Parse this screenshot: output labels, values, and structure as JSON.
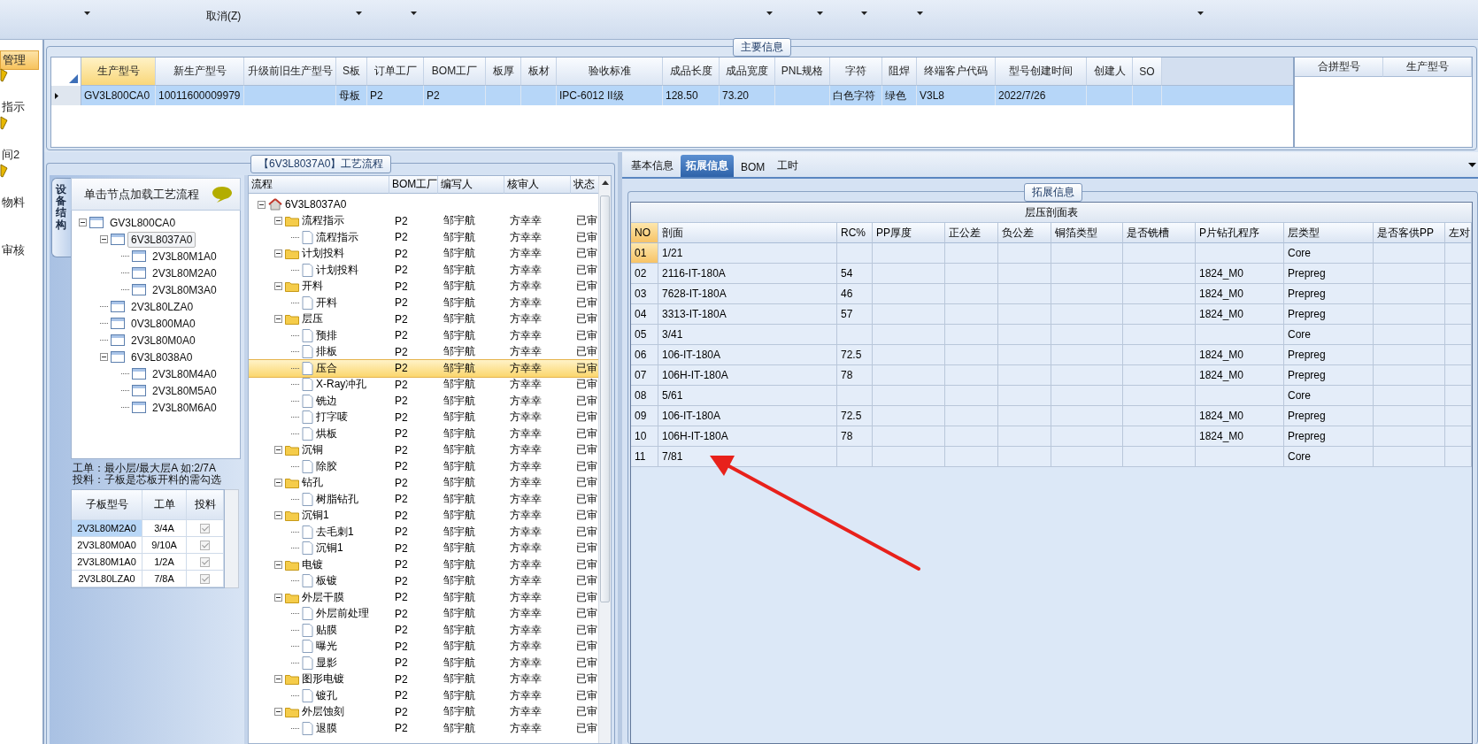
{
  "toolbar": {
    "label": "取消(Z)"
  },
  "sidebar": {
    "items": [
      {
        "label": "管理",
        "has_icon": false,
        "selected": true
      },
      {
        "label": "指示",
        "has_icon": true,
        "selected": false
      },
      {
        "label": "间2",
        "has_icon": true,
        "selected": false
      },
      {
        "label": "物料",
        "has_icon": true,
        "selected": false
      },
      {
        "label": "审核",
        "has_icon": false,
        "selected": false
      }
    ]
  },
  "main_info": {
    "title": "主要信息",
    "columns": [
      {
        "label": "生产型号",
        "selected": true
      },
      {
        "label": "新生产型号",
        "selected": false
      },
      {
        "label": "升级前旧生产型号",
        "selected": false
      },
      {
        "label": "S板",
        "selected": false
      },
      {
        "label": "订单工厂",
        "selected": false
      },
      {
        "label": "BOM工厂",
        "selected": false
      },
      {
        "label": "板厚",
        "selected": false
      },
      {
        "label": "板材",
        "selected": false
      },
      {
        "label": "验收标准",
        "selected": false
      },
      {
        "label": "成品长度",
        "selected": false
      },
      {
        "label": "成品宽度",
        "selected": false
      },
      {
        "label": "PNL规格",
        "selected": false
      },
      {
        "label": "字符",
        "selected": false
      },
      {
        "label": "阻焊",
        "selected": false
      },
      {
        "label": "终端客户代码",
        "selected": false
      },
      {
        "label": "型号创建时间",
        "selected": false
      },
      {
        "label": "创建人",
        "selected": false
      },
      {
        "label": "SO",
        "selected": false
      }
    ],
    "rows": [
      {
        "selected": true,
        "cells": [
          "GV3L800CA0",
          "10011600009979",
          "",
          "母板",
          "P2",
          "P2",
          "",
          "",
          "IPC-6012 II级",
          "128.50",
          "73.20",
          "",
          "白色字符",
          "绿色",
          "V3L8",
          "2022/7/26",
          "",
          ""
        ]
      }
    ],
    "merge_columns": [
      "合拼型号",
      "生产型号"
    ]
  },
  "flow": {
    "title": "【6V3L8037A0】工艺流程",
    "structure": {
      "tab": "设备结构",
      "hint": "单击节点加载工艺流程",
      "tree": [
        {
          "label": "GV3L800CA0",
          "expanded": true,
          "selected": false,
          "children": [
            {
              "label": "6V3L8037A0",
              "expanded": true,
              "selected": true,
              "children": [
                {
                  "label": "2V3L80M1A0",
                  "selected": false
                },
                {
                  "label": "2V3L80M2A0",
                  "selected": false
                },
                {
                  "label": "2V3L80M3A0",
                  "selected": false
                }
              ]
            },
            {
              "label": "2V3L80LZA0",
              "selected": false
            },
            {
              "label": "0V3L800MA0",
              "selected": false
            },
            {
              "label": "2V3L80M0A0",
              "selected": false
            },
            {
              "label": "6V3L8038A0",
              "expanded": true,
              "selected": false,
              "children": [
                {
                  "label": "2V3L80M4A0",
                  "selected": false
                },
                {
                  "label": "2V3L80M5A0",
                  "selected": false
                },
                {
                  "label": "2V3L80M6A0",
                  "selected": false
                }
              ]
            }
          ]
        }
      ],
      "notes": [
        "工单：最小层/最大层A 如:2/7A",
        "投料：子板是芯板开料的需勾选"
      ],
      "grid": {
        "columns": [
          "子板型号",
          "工单",
          "投料"
        ],
        "rows": [
          {
            "model": "2V3L80M2A0",
            "order": "3/4A",
            "checked": true,
            "selected": true
          },
          {
            "model": "2V3L80M0A0",
            "order": "9/10A",
            "checked": true,
            "selected": false
          },
          {
            "model": "2V3L80M1A0",
            "order": "1/2A",
            "checked": true,
            "selected": false
          },
          {
            "model": "2V3L80LZA0",
            "order": "7/8A",
            "checked": true,
            "selected": false
          }
        ]
      }
    },
    "columns": [
      "流程",
      "BOM工厂",
      "编写人",
      "核审人",
      "状态"
    ],
    "tree": [
      {
        "kind": "root",
        "label": "6V3L8037A0",
        "expanded": true,
        "selected": false,
        "children": [
          {
            "kind": "folder",
            "label": "流程指示",
            "bom": "P2",
            "writer": "邹宇航",
            "reviewer": "方幸幸",
            "status": "已审",
            "expanded": true,
            "selected": false,
            "children": [
              {
                "kind": "step",
                "label": "流程指示",
                "bom": "P2",
                "writer": "邹宇航",
                "reviewer": "方幸幸",
                "status": "已审",
                "selected": false
              }
            ]
          },
          {
            "kind": "folder",
            "label": "计划投料",
            "bom": "P2",
            "writer": "邹宇航",
            "reviewer": "方幸幸",
            "status": "已审",
            "expanded": true,
            "selected": false,
            "children": [
              {
                "kind": "step",
                "label": "计划投料",
                "bom": "P2",
                "writer": "邹宇航",
                "reviewer": "方幸幸",
                "status": "已审",
                "selected": false
              }
            ]
          },
          {
            "kind": "folder",
            "label": "开料",
            "bom": "P2",
            "writer": "邹宇航",
            "reviewer": "方幸幸",
            "status": "已审",
            "expanded": true,
            "selected": false,
            "children": [
              {
                "kind": "step",
                "label": "开料",
                "bom": "P2",
                "writer": "邹宇航",
                "reviewer": "方幸幸",
                "status": "已审",
                "selected": false
              }
            ]
          },
          {
            "kind": "folder",
            "label": "层压",
            "bom": "P2",
            "writer": "邹宇航",
            "reviewer": "方幸幸",
            "status": "已审",
            "expanded": true,
            "selected": false,
            "children": [
              {
                "kind": "step",
                "label": "预排",
                "bom": "P2",
                "writer": "邹宇航",
                "reviewer": "方幸幸",
                "status": "已审",
                "selected": false
              },
              {
                "kind": "step",
                "label": "排板",
                "bom": "P2",
                "writer": "邹宇航",
                "reviewer": "方幸幸",
                "status": "已审",
                "selected": false
              },
              {
                "kind": "step",
                "label": "压合",
                "bom": "P2",
                "writer": "邹宇航",
                "reviewer": "方幸幸",
                "status": "已审",
                "selected": true
              },
              {
                "kind": "step",
                "label": "X-Ray冲孔",
                "bom": "P2",
                "writer": "邹宇航",
                "reviewer": "方幸幸",
                "status": "已审",
                "selected": false
              },
              {
                "kind": "step",
                "label": "铣边",
                "bom": "P2",
                "writer": "邹宇航",
                "reviewer": "方幸幸",
                "status": "已审",
                "selected": false
              },
              {
                "kind": "step",
                "label": "打字唛",
                "bom": "P2",
                "writer": "邹宇航",
                "reviewer": "方幸幸",
                "status": "已审",
                "selected": false
              },
              {
                "kind": "step",
                "label": "烘板",
                "bom": "P2",
                "writer": "邹宇航",
                "reviewer": "方幸幸",
                "status": "已审",
                "selected": false
              }
            ]
          },
          {
            "kind": "folder",
            "label": "沉铜",
            "bom": "P2",
            "writer": "邹宇航",
            "reviewer": "方幸幸",
            "status": "已审",
            "expanded": true,
            "selected": false,
            "children": [
              {
                "kind": "step",
                "label": "除胶",
                "bom": "P2",
                "writer": "邹宇航",
                "reviewer": "方幸幸",
                "status": "已审",
                "selected": false
              }
            ]
          },
          {
            "kind": "folder",
            "label": "钻孔",
            "bom": "P2",
            "writer": "邹宇航",
            "reviewer": "方幸幸",
            "status": "已审",
            "expanded": true,
            "selected": false,
            "children": [
              {
                "kind": "step",
                "label": "树脂钻孔",
                "bom": "P2",
                "writer": "邹宇航",
                "reviewer": "方幸幸",
                "status": "已审",
                "selected": false
              }
            ]
          },
          {
            "kind": "folder",
            "label": "沉铜1",
            "bom": "P2",
            "writer": "邹宇航",
            "reviewer": "方幸幸",
            "status": "已审",
            "expanded": true,
            "selected": false,
            "children": [
              {
                "kind": "step",
                "label": "去毛刺1",
                "bom": "P2",
                "writer": "邹宇航",
                "reviewer": "方幸幸",
                "status": "已审",
                "selected": false
              },
              {
                "kind": "step",
                "label": "沉铜1",
                "bom": "P2",
                "writer": "邹宇航",
                "reviewer": "方幸幸",
                "status": "已审",
                "selected": false
              }
            ]
          },
          {
            "kind": "folder",
            "label": "电镀",
            "bom": "P2",
            "writer": "邹宇航",
            "reviewer": "方幸幸",
            "status": "已审",
            "expanded": true,
            "selected": false,
            "children": [
              {
                "kind": "step",
                "label": "板镀",
                "bom": "P2",
                "writer": "邹宇航",
                "reviewer": "方幸幸",
                "status": "已审",
                "selected": false
              }
            ]
          },
          {
            "kind": "folder",
            "label": "外层干膜",
            "bom": "P2",
            "writer": "邹宇航",
            "reviewer": "方幸幸",
            "status": "已审",
            "expanded": true,
            "selected": false,
            "children": [
              {
                "kind": "step",
                "label": "外层前处理",
                "bom": "P2",
                "writer": "邹宇航",
                "reviewer": "方幸幸",
                "status": "已审",
                "selected": false
              },
              {
                "kind": "step",
                "label": "贴膜",
                "bom": "P2",
                "writer": "邹宇航",
                "reviewer": "方幸幸",
                "status": "已审",
                "selected": false
              },
              {
                "kind": "step",
                "label": "曝光",
                "bom": "P2",
                "writer": "邹宇航",
                "reviewer": "方幸幸",
                "status": "已审",
                "selected": false
              },
              {
                "kind": "step",
                "label": "显影",
                "bom": "P2",
                "writer": "邹宇航",
                "reviewer": "方幸幸",
                "status": "已审",
                "selected": false
              }
            ]
          },
          {
            "kind": "folder",
            "label": "图形电镀",
            "bom": "P2",
            "writer": "邹宇航",
            "reviewer": "方幸幸",
            "status": "已审",
            "expanded": true,
            "selected": false,
            "children": [
              {
                "kind": "step",
                "label": "镀孔",
                "bom": "P2",
                "writer": "邹宇航",
                "reviewer": "方幸幸",
                "status": "已审",
                "selected": false
              }
            ]
          },
          {
            "kind": "folder",
            "label": "外层蚀刻",
            "bom": "P2",
            "writer": "邹宇航",
            "reviewer": "方幸幸",
            "status": "已审",
            "expanded": true,
            "selected": false,
            "children": [
              {
                "kind": "step",
                "label": "退膜",
                "bom": "P2",
                "writer": "邹宇航",
                "reviewer": "方幸幸",
                "status": "已审",
                "selected": false
              }
            ]
          }
        ]
      }
    ]
  },
  "ext": {
    "tabs": [
      {
        "label": "基本信息",
        "selected": false
      },
      {
        "label": "拓展信息",
        "selected": true
      },
      {
        "label": "BOM",
        "selected": false
      },
      {
        "label": "工时",
        "selected": false
      }
    ],
    "group_title": "拓展信息",
    "table": {
      "title": "层压剖面表",
      "columns": [
        "NO",
        "剖面",
        "RC%",
        "PP厚度",
        "正公差",
        "负公差",
        "铜箔类型",
        "是否铣槽",
        "P片钻孔程序",
        "层类型",
        "是否客供PP",
        "左对"
      ],
      "rows": [
        {
          "selected": true,
          "cells": [
            "01",
            "1/21",
            "",
            "",
            "",
            "",
            "",
            "",
            "",
            "Core",
            "",
            ""
          ]
        },
        {
          "selected": false,
          "cells": [
            "02",
            "2116-IT-180A",
            "54",
            "",
            "",
            "",
            "",
            "",
            "1824_M0",
            "Prepreg",
            "",
            ""
          ]
        },
        {
          "selected": false,
          "cells": [
            "03",
            "7628-IT-180A",
            "46",
            "",
            "",
            "",
            "",
            "",
            "1824_M0",
            "Prepreg",
            "",
            ""
          ]
        },
        {
          "selected": false,
          "cells": [
            "04",
            "3313-IT-180A",
            "57",
            "",
            "",
            "",
            "",
            "",
            "1824_M0",
            "Prepreg",
            "",
            ""
          ]
        },
        {
          "selected": false,
          "cells": [
            "05",
            "3/41",
            "",
            "",
            "",
            "",
            "",
            "",
            "",
            "Core",
            "",
            ""
          ]
        },
        {
          "selected": false,
          "cells": [
            "06",
            "106-IT-180A",
            "72.5",
            "",
            "",
            "",
            "",
            "",
            "1824_M0",
            "Prepreg",
            "",
            ""
          ]
        },
        {
          "selected": false,
          "cells": [
            "07",
            "106H-IT-180A",
            "78",
            "",
            "",
            "",
            "",
            "",
            "1824_M0",
            "Prepreg",
            "",
            ""
          ]
        },
        {
          "selected": false,
          "cells": [
            "08",
            "5/61",
            "",
            "",
            "",
            "",
            "",
            "",
            "",
            "Core",
            "",
            ""
          ]
        },
        {
          "selected": false,
          "cells": [
            "09",
            "106-IT-180A",
            "72.5",
            "",
            "",
            "",
            "",
            "",
            "1824_M0",
            "Prepreg",
            "",
            ""
          ]
        },
        {
          "selected": false,
          "cells": [
            "10",
            "106H-IT-180A",
            "78",
            "",
            "",
            "",
            "",
            "",
            "1824_M0",
            "Prepreg",
            "",
            ""
          ]
        },
        {
          "selected": false,
          "cells": [
            "11",
            "7/81",
            "",
            "",
            "",
            "",
            "",
            "",
            "",
            "Core",
            "",
            ""
          ]
        }
      ]
    }
  },
  "annotation": {
    "kind": "arrow"
  }
}
